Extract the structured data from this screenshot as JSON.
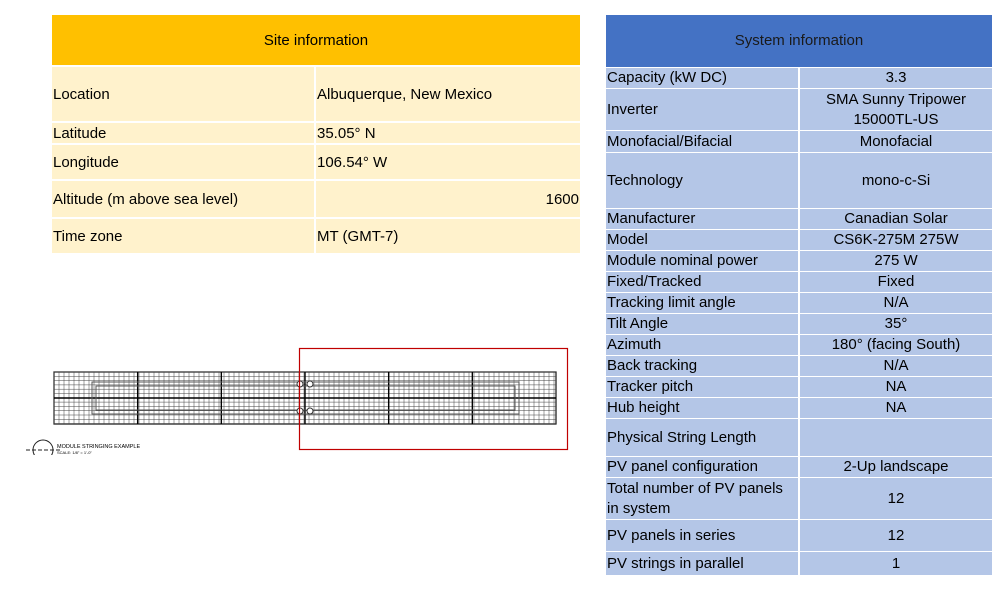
{
  "site": {
    "title": "Site information",
    "rows": [
      {
        "label": "Location",
        "value": "Albuquerque, New Mexico"
      },
      {
        "label": "Latitude",
        "value": "35.05° N"
      },
      {
        "label": "Longitude",
        "value": "106.54° W"
      },
      {
        "label": "Altitude (m above sea level)",
        "value": "1600"
      },
      {
        "label": "Time zone",
        "value": "MT (GMT-7)"
      }
    ]
  },
  "system": {
    "title": "System information",
    "rows": [
      {
        "label": "Capacity (kW DC)",
        "value": "3.3"
      },
      {
        "label": "Inverter",
        "value": "SMA Sunny Tripower 15000TL-US"
      },
      {
        "label": "Monofacial/Bifacial",
        "value": "Monofacial"
      },
      {
        "label": "Technology",
        "value": "mono-c-Si"
      },
      {
        "label": "Manufacturer",
        "value": "Canadian Solar"
      },
      {
        "label": "Model",
        "value": "CS6K-275M 275W"
      },
      {
        "label": "Module nominal power",
        "value": "275 W"
      },
      {
        "label": "Fixed/Tracked",
        "value": "Fixed"
      },
      {
        "label": "Tracking limit angle",
        "value": "N/A"
      },
      {
        "label": "Tilt Angle",
        "value": "35°"
      },
      {
        "label": "Azimuth",
        "value": "180° (facing South)"
      },
      {
        "label": "Back tracking",
        "value": "N/A"
      },
      {
        "label": "Tracker pitch",
        "value": "NA"
      },
      {
        "label": "Hub height",
        "value": "NA"
      },
      {
        "label": "Physical String Length",
        "value": ""
      },
      {
        "label": "PV panel configuration",
        "value": "2-Up landscape"
      },
      {
        "label": "Total number of PV panels in system",
        "value": "12"
      },
      {
        "label": "PV panels in series",
        "value": "12"
      },
      {
        "label": "PV strings in parallel",
        "value": "1"
      }
    ]
  },
  "drawing": {
    "caption": "MODULE STRINGING EXAMPLE",
    "scale": "SCALE: 1/8\" = 1'-0\"",
    "highlight_color": "#c00000"
  }
}
